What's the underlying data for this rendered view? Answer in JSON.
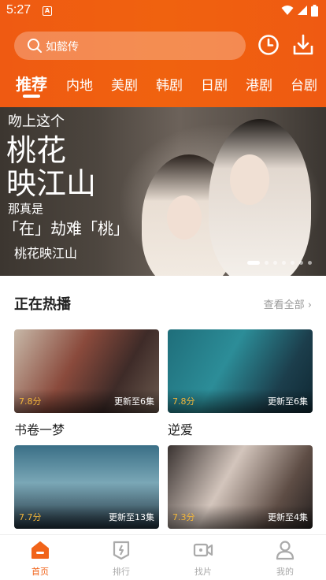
{
  "status": {
    "time": "5:27"
  },
  "search": {
    "placeholder": "如懿传"
  },
  "header": {
    "history_icon": "clock-icon",
    "download_icon": "download-icon"
  },
  "tabs": [
    {
      "label": "推荐",
      "active": true
    },
    {
      "label": "内地"
    },
    {
      "label": "美剧"
    },
    {
      "label": "韩剧"
    },
    {
      "label": "日剧"
    },
    {
      "label": "港剧"
    },
    {
      "label": "台剧"
    }
  ],
  "banner": {
    "title": "桃花映江山",
    "poster_lines": [
      "吻上这个",
      "桃花",
      "映江山",
      "那真是",
      "「在」劫难「桃」"
    ],
    "dot_count": 7,
    "active_dot": 0
  },
  "section": {
    "title": "正在热播",
    "view_all": "查看全部 ›"
  },
  "cards": [
    {
      "title": "书卷一梦",
      "score": "7.8分",
      "update": "更新至6集"
    },
    {
      "title": "逆爱",
      "score": "7.8分",
      "update": "更新至6集"
    },
    {
      "title": "",
      "score": "7.7分",
      "update": "更新至13集"
    },
    {
      "title": "",
      "score": "7.3分",
      "update": "更新至4集"
    }
  ],
  "nav": [
    {
      "label": "首页",
      "icon": "home-icon",
      "active": true
    },
    {
      "label": "排行",
      "icon": "ranking-icon"
    },
    {
      "label": "找片",
      "icon": "video-camera-icon"
    },
    {
      "label": "我的",
      "icon": "profile-icon"
    }
  ],
  "colors": {
    "accent": "#f1641a",
    "header": "#ef5a12",
    "score": "#f3b63a"
  }
}
